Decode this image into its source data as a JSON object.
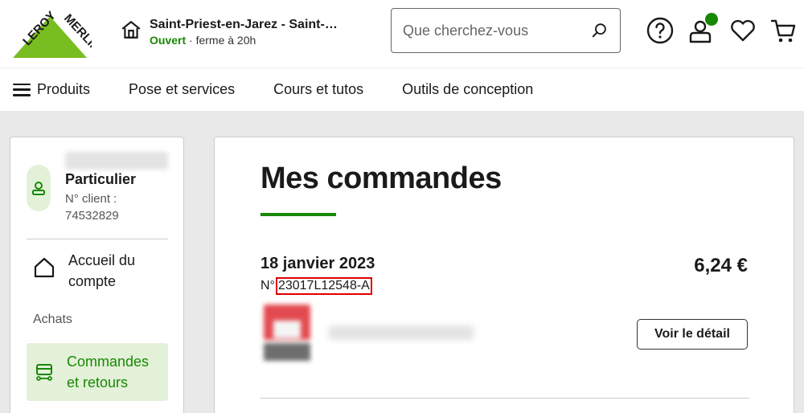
{
  "brand": {
    "name": "LEROY MERLIN",
    "color": "#188803"
  },
  "header": {
    "store_name": "Saint-Priest-en-Jarez - Saint-…",
    "store_status": "Ouvert",
    "store_hours": "· ferme à 20h",
    "search_placeholder": "Que cherchez-vous",
    "icons": [
      "help-icon",
      "account-icon",
      "wishlist-icon",
      "cart-icon"
    ]
  },
  "nav": {
    "items": [
      "Produits",
      "Pose et services",
      "Cours et tutos",
      "Outils de conception"
    ]
  },
  "sidebar": {
    "account_type": "Particulier",
    "client_number_line1": "N° client :",
    "client_number_line2": "74532829",
    "home_label": "Accueil du compte",
    "section_purchases": "Achats",
    "orders_label": "Commandes et retours"
  },
  "main": {
    "title": "Mes commandes",
    "orders": [
      {
        "date": "18 janvier 2023",
        "number_prefix": "N°",
        "number": "23017L12548-A",
        "price": "6,24 €",
        "detail_button": "Voir le détail"
      }
    ]
  }
}
